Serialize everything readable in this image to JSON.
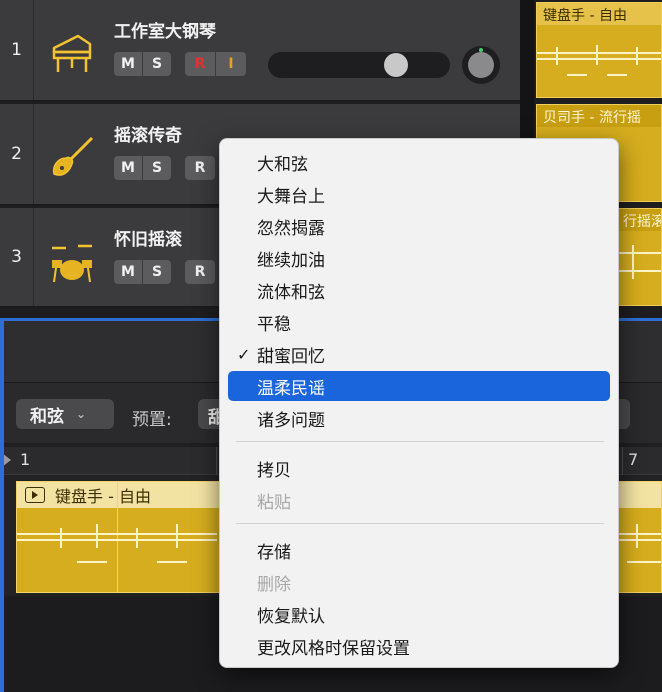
{
  "tracks": [
    {
      "number": "1",
      "name": "工作室大钢琴",
      "icon": "piano-icon",
      "buttons": {
        "m": "M",
        "s": "S",
        "r": "R",
        "i": "I"
      }
    },
    {
      "number": "2",
      "name": "摇滚传奇",
      "icon": "bass-guitar-icon",
      "buttons": {
        "m": "M",
        "s": "S",
        "r": "R"
      }
    },
    {
      "number": "3",
      "name": "怀旧摇滚",
      "icon": "drum-kit-icon",
      "buttons": {
        "m": "M",
        "s": "S",
        "r": "R"
      }
    }
  ],
  "regions": {
    "r1_title": "键盘手 - 自由",
    "r2_title": "贝司手 - 流行摇",
    "r3_title": "行摇滚"
  },
  "editor": {
    "chord_button": "和弦",
    "preset_label": "预置:",
    "preset_value": "甜",
    "ruler": {
      "start": "1",
      "mark7": "7"
    },
    "region_title": "键盘手 - 自由"
  },
  "menu": {
    "items": [
      {
        "label": "大和弦",
        "enabled": true
      },
      {
        "label": "大舞台上",
        "enabled": true
      },
      {
        "label": "忽然揭露",
        "enabled": true
      },
      {
        "label": "继续加油",
        "enabled": true
      },
      {
        "label": "流体和弦",
        "enabled": true
      },
      {
        "label": "平稳",
        "enabled": true
      },
      {
        "label": "甜蜜回忆",
        "enabled": true,
        "checked": true
      },
      {
        "label": "温柔民谣",
        "enabled": true,
        "highlighted": true
      },
      {
        "label": "诸多问题",
        "enabled": true
      }
    ],
    "edit_items": [
      {
        "label": "拷贝",
        "enabled": true
      },
      {
        "label": "粘贴",
        "enabled": false
      }
    ],
    "file_items": [
      {
        "label": "存储",
        "enabled": true
      },
      {
        "label": "删除",
        "enabled": false
      },
      {
        "label": "恢复默认",
        "enabled": true
      },
      {
        "label": "更改风格时保留设置",
        "enabled": true
      }
    ],
    "check_mark": "✓"
  },
  "colors": {
    "region_yellow": "#d6ad1e",
    "highlight_blue": "#1a64dc",
    "record_red": "#e0322e",
    "input_orange": "#e8a020"
  }
}
